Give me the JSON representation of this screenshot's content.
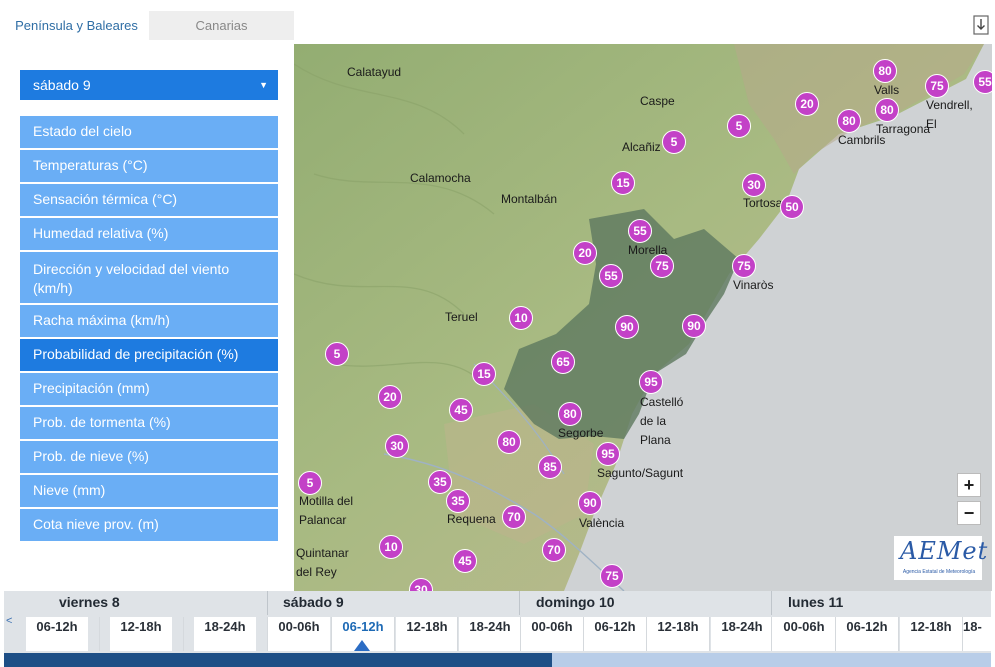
{
  "tabs": [
    "Península y Baleares",
    "Canarias"
  ],
  "selected_day": "sábado 9",
  "menu": [
    "Estado del cielo",
    "Temperaturas (°C)",
    "Sensación térmica (°C)",
    "Humedad relativa (%)",
    "Dirección y velocidad del viento (km/h)",
    "Racha máxima (km/h)",
    "Probabilidad de precipitación (%)",
    "Precipitación (mm)",
    "Prob. de tormenta (%)",
    "Prob. de nieve (%)",
    "Nieve (mm)",
    "Cota nieve prov. (m)"
  ],
  "active_menu_index": 6,
  "cities": [
    "Calatayud",
    "Caspe",
    "Valls",
    "Vendrell, El",
    "Tarragona",
    "Cambrils",
    "Alcañiz",
    "Calamocha",
    "Montalbán",
    "Tortosa",
    "Morella",
    "Vinaròs",
    "Teruel",
    "Castelló de la Plana",
    "Segorbe",
    "Sagunto/Sagunt",
    "Motilla del Palancar",
    "Requena",
    "València",
    "Quintanar del Rey"
  ],
  "probabilities": [
    80,
    75,
    55,
    20,
    80,
    80,
    5,
    5,
    15,
    30,
    50,
    55,
    20,
    75,
    55,
    75,
    10,
    90,
    90,
    5,
    65,
    15,
    95,
    20,
    45,
    80,
    30,
    80,
    85,
    95,
    5,
    35,
    35,
    70,
    90,
    10,
    70,
    45,
    75,
    30
  ],
  "zoom": {
    "in": "+",
    "out": "−"
  },
  "logo": {
    "mark": "AEMet",
    "subtitle": "Agencia Estatal de Meteorología"
  },
  "days": [
    "viernes 8",
    "sábado 9",
    "domingo 10",
    "lunes 11"
  ],
  "slots": [
    "06-12h",
    "12-18h",
    "18-24h",
    "00-06h",
    "06-12h",
    "12-18h",
    "18-24h",
    "00-06h",
    "06-12h",
    "12-18h",
    "18-24h",
    "00-06h",
    "06-12h",
    "12-18h",
    "18-"
  ],
  "active_slot_index": 4,
  "timeline_progress": 0.555,
  "nav": {
    "prev": "<",
    "next": ">"
  },
  "colors": {
    "accent": "#1e7be0",
    "menu": "#6aaef5",
    "pin": "#c341c7",
    "region_highlight": "#5f7a60"
  }
}
